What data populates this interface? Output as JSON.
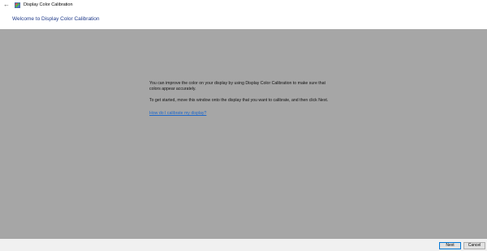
{
  "window": {
    "title": "Display Color Calibration",
    "back_glyph": "←"
  },
  "header": {
    "title": "Welcome to Display Color Calibration"
  },
  "content": {
    "paragraph1": "You can improve the color on your display by using Display Color Calibration to make sure that colors appear accurately.",
    "paragraph2": "To get started, move this window onto the display that you want to calibrate, and then click Next.",
    "help_link": "How do I calibrate my display?"
  },
  "footer": {
    "next_label": "Next",
    "cancel_label": "Cancel"
  },
  "colors": {
    "content_background": "#a6a6a6",
    "header_title": "#1f3a8a",
    "link": "#1a66cc",
    "footer_background": "#f0f0f0"
  },
  "icons": {
    "back": "back-arrow-icon",
    "app": "color-calibration-icon"
  }
}
